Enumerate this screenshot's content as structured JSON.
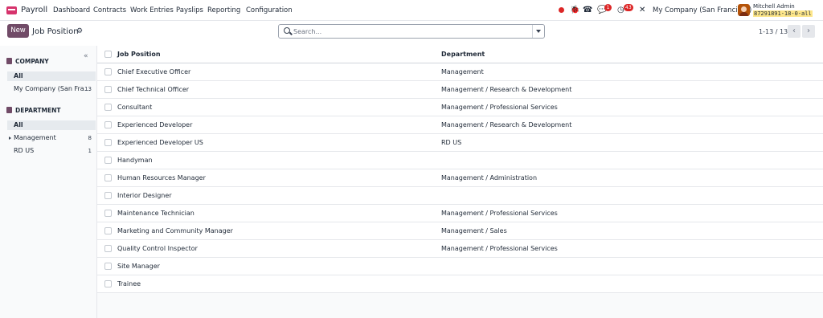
{
  "app": {
    "name": "Payroll",
    "brand_color": "#714B67"
  },
  "menu": [
    "Dashboard",
    "Contracts",
    "Work Entries",
    "Payslips",
    "Reporting",
    "Configuration"
  ],
  "systray": {
    "messages_count": "1",
    "activities_count": "43",
    "company": "My Company (San Francisco)",
    "user_name": "Mitchell Admin",
    "db_name": "87291891-18-0-all"
  },
  "control": {
    "new_label": "New",
    "title": "Job Position",
    "search_placeholder": "Search...",
    "pager": "1-13 / 13"
  },
  "sidebar": {
    "company_heading": "COMPANY",
    "company_items": [
      {
        "label": "All",
        "count": ""
      },
      {
        "label": "My Company (San Fra…",
        "count": "13"
      }
    ],
    "department_heading": "DEPARTMENT",
    "department_items": [
      {
        "label": "All",
        "count": ""
      },
      {
        "label": "Management",
        "count": "8"
      },
      {
        "label": "RD US",
        "count": "1"
      }
    ]
  },
  "table": {
    "headers": [
      "Job Position",
      "Department"
    ],
    "rows": [
      [
        "Chief Executive Officer",
        "Management"
      ],
      [
        "Chief Technical Officer",
        "Management / Research & Development"
      ],
      [
        "Consultant",
        "Management / Professional Services"
      ],
      [
        "Experienced Developer",
        "Management / Research & Development"
      ],
      [
        "Experienced Developer US",
        "RD US"
      ],
      [
        "Handyman",
        ""
      ],
      [
        "Human Resources Manager",
        "Management / Administration"
      ],
      [
        "Interior Designer",
        ""
      ],
      [
        "Maintenance Technician",
        "Management / Professional Services"
      ],
      [
        "Marketing and Community Manager",
        "Management / Sales"
      ],
      [
        "Quality Control Inspector",
        "Management / Professional Services"
      ],
      [
        "Site Manager",
        ""
      ],
      [
        "Trainee",
        ""
      ]
    ]
  }
}
